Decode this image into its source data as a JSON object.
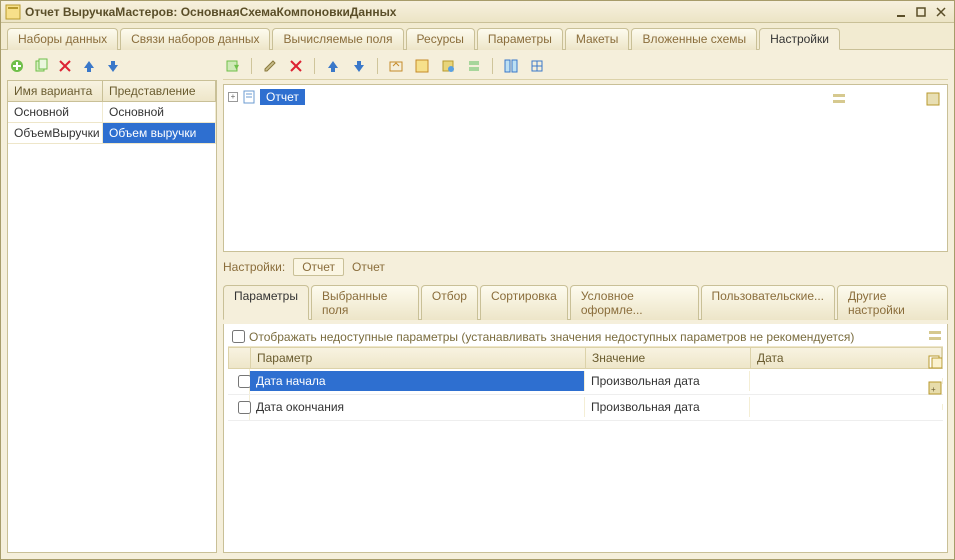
{
  "window": {
    "title": "Отчет ВыручкаМастеров: ОсновнаяСхемаКомпоновкиДанных"
  },
  "main_tabs": [
    {
      "label": "Наборы данных",
      "active": false
    },
    {
      "label": "Связи наборов данных",
      "active": false
    },
    {
      "label": "Вычисляемые поля",
      "active": false
    },
    {
      "label": "Ресурсы",
      "active": false
    },
    {
      "label": "Параметры",
      "active": false
    },
    {
      "label": "Макеты",
      "active": false
    },
    {
      "label": "Вложенные схемы",
      "active": false
    },
    {
      "label": "Настройки",
      "active": true
    }
  ],
  "variant_table": {
    "headers": {
      "name": "Имя варианта",
      "repr": "Представление"
    },
    "rows": [
      {
        "name": "Основной",
        "repr": "Основной",
        "selected": false
      },
      {
        "name": "ОбъемВыручки",
        "repr": "Объем выручки",
        "selected": true
      }
    ]
  },
  "tree": {
    "root_label": "Отчет"
  },
  "settings_caption": "Настройки:",
  "settings_pill": "Отчет",
  "settings_text": "Отчет",
  "sub_tabs": [
    {
      "label": "Параметры",
      "active": true
    },
    {
      "label": "Выбранные поля",
      "active": false
    },
    {
      "label": "Отбор",
      "active": false
    },
    {
      "label": "Сортировка",
      "active": false
    },
    {
      "label": "Условное оформле...",
      "active": false
    },
    {
      "label": "Пользовательские...",
      "active": false
    },
    {
      "label": "Другие настройки",
      "active": false
    }
  ],
  "hint": "Отображать недоступные параметры (устанавливать значения недоступных параметров не рекомендуется)",
  "ptable": {
    "headers": {
      "param": "Параметр",
      "value": "Значение",
      "date": "Дата"
    },
    "rows": [
      {
        "param": "Дата начала",
        "value": "Произвольная дата",
        "date": "",
        "selected": true
      },
      {
        "param": "Дата окончания",
        "value": "Произвольная дата",
        "date": "",
        "selected": false
      }
    ]
  }
}
